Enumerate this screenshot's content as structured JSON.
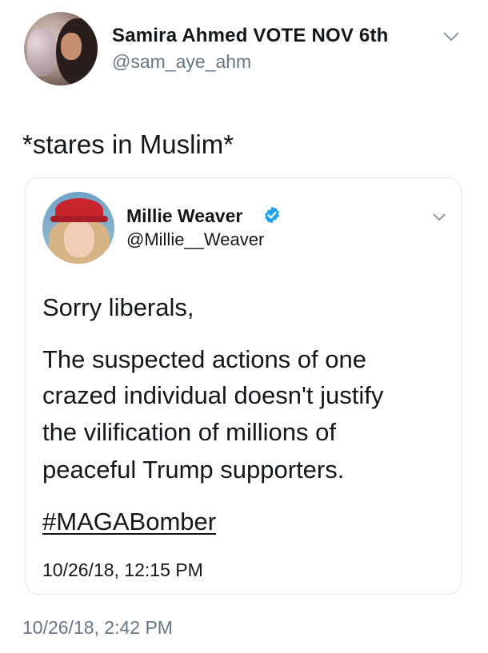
{
  "tweet": {
    "author_name": "Samira Ahmed VOTE NOV 6th",
    "author_handle": "@sam_aye_ahm",
    "text": "*stares in Muslim*",
    "timestamp": "10/26/18, 2:42 PM",
    "avatar_icon": "profile-photo",
    "menu_icon": "chevron-down-icon"
  },
  "quoted_tweet": {
    "author_name": "Millie Weaver",
    "author_handle": "@Millie__Weaver",
    "verified": true,
    "verified_color": "#1da1f2",
    "lines": [
      "Sorry liberals,",
      "The suspected actions of one",
      "crazed individual doesn't justify",
      "the vilification of millions of",
      "peaceful Trump supporters."
    ],
    "hashtag": "#MAGABomber",
    "timestamp": "10/26/18, 12:15 PM",
    "avatar_icon": "profile-photo",
    "menu_icon": "chevron-down-icon"
  },
  "colors": {
    "text": "#14171a",
    "secondary_text": "#657786",
    "border": "#e1e8ed"
  }
}
